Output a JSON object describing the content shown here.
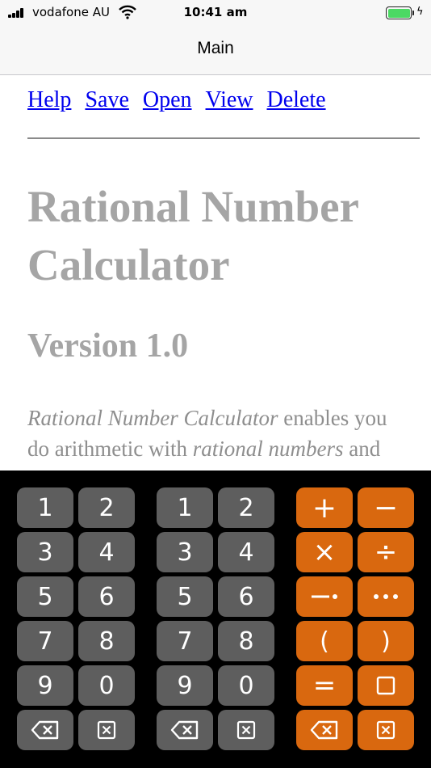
{
  "status_bar": {
    "carrier": "vodafone AU",
    "time": "10:41 am",
    "battery_charging_symbol": "ϟ",
    "icons": [
      "signal-bars-icon",
      "wifi-icon",
      "battery-icon"
    ]
  },
  "nav": {
    "title": "Main"
  },
  "links": [
    "Help",
    "Save",
    "Open",
    "View",
    "Delete"
  ],
  "content": {
    "title": "Rational Number Calculator",
    "version": "Version 1.0",
    "para_line1_italic": "Rational Number Calculator",
    "para_line1_rest": " enables you",
    "para_line2_start": "do arithmetic with ",
    "para_line2_italic": "rational numbers",
    "para_line2_end": " and"
  },
  "colors": {
    "link": "#0000ee",
    "heading": "#a5a5a5",
    "key_gray": "#5e5e5e",
    "key_orange": "#d9680f"
  },
  "keypad": {
    "left_digits": [
      "1",
      "2",
      "3",
      "4",
      "5",
      "6",
      "7",
      "8",
      "9",
      "0"
    ],
    "right_digits": [
      "1",
      "2",
      "3",
      "4",
      "5",
      "6",
      "7",
      "8",
      "9",
      "0"
    ],
    "operators": [
      "+",
      "−",
      "×",
      "÷",
      "(",
      ")",
      "="
    ],
    "icon_keys": [
      "backspace-icon",
      "clear-icon",
      "negate-dot-icon",
      "ellipsis-icon",
      "square-icon"
    ]
  }
}
